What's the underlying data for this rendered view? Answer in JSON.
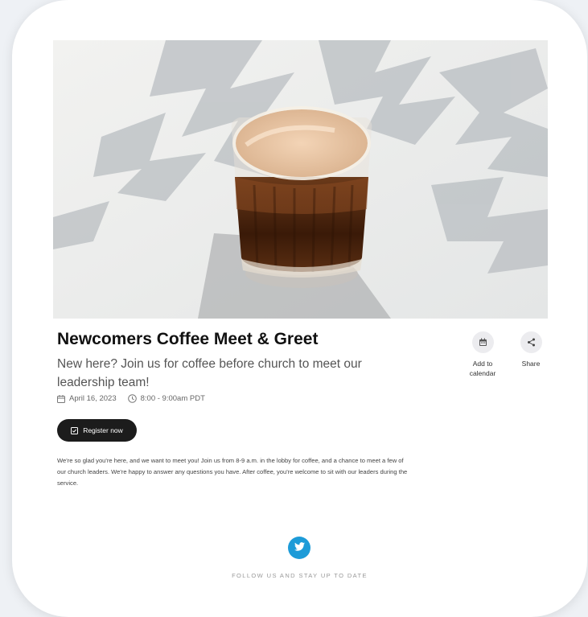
{
  "event": {
    "title": "Newcomers Coffee Meet & Greet",
    "subtitle": "New here? Join us for coffee before church to meet our leadership team!",
    "date": "April 16, 2023",
    "time": "8:00 - 9:00am PDT",
    "description": "We're so glad you're here, and we want to meet you! Join us from 8-9 a.m. in the lobby for coffee, and a chance to meet a few of our church leaders. We're happy to answer any questions you have. After coffee, you're welcome to sit with our leaders during the service."
  },
  "actions": {
    "register_label": "Register now",
    "add_to_calendar_label": "Add to calendar",
    "share_label": "Share"
  },
  "footer": {
    "follow_text": "FOLLOW US AND STAY UP TO DATE"
  },
  "icons": {
    "calendar": "calendar-icon",
    "clock": "clock-icon",
    "register": "checkbox-calendar-icon",
    "share": "share-icon",
    "social": "twitter-icon"
  },
  "colors": {
    "button_dark": "#1c1c1c",
    "twitter_blue": "#1d9bd8",
    "card_bg": "#ffffff",
    "page_bg": "#eef1f5"
  }
}
